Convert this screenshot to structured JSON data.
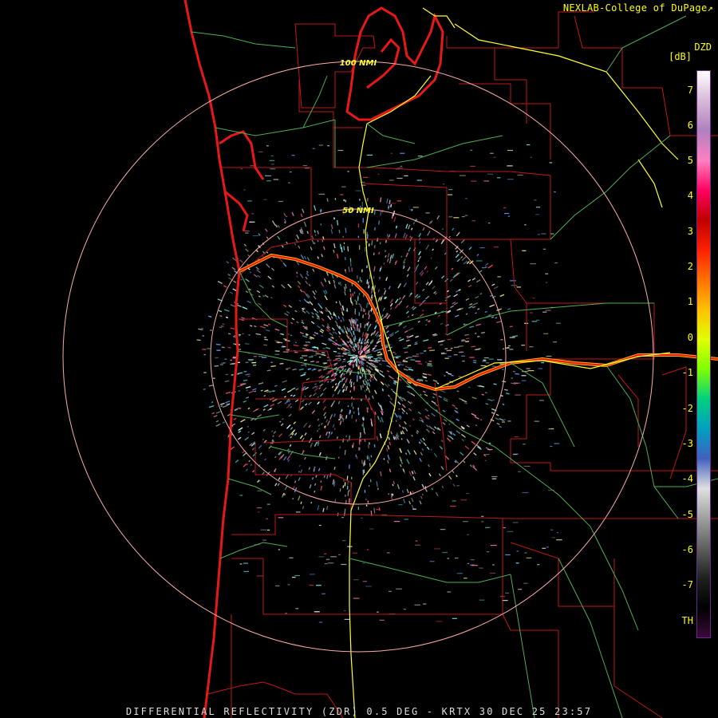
{
  "credit": "NEXLAB-College of DuPage",
  "external_link_icon": "external-link-icon",
  "product_code": "DZD",
  "unit": "[dB]",
  "colorbar": {
    "ticks": [
      "7",
      "6",
      "5",
      "4",
      "3",
      "2",
      "1",
      "0",
      "-1",
      "-2",
      "-3",
      "-4",
      "-5",
      "-6",
      "-7",
      "TH"
    ],
    "colors": [
      "#ffffff",
      "#d8b8d8",
      "#b080c0",
      "#ff80c0",
      "#ff0060",
      "#c00000",
      "#ff2000",
      "#ff7000",
      "#ffc000",
      "#e0ff00",
      "#80ff00",
      "#00d080",
      "#00a0c0",
      "#4060c0",
      "#e0e0e0",
      "#a0a0a0",
      "#606060",
      "#202020",
      "#000000",
      "#3a0a3a"
    ]
  },
  "range_rings": [
    {
      "label": "50 NMI"
    },
    {
      "label": "100 NMI"
    }
  ],
  "footer": "DIFFERENTIAL REFLECTIVITY (ZDR) 0.5 DEG - KRTX 30 DEC 25 23:57"
}
